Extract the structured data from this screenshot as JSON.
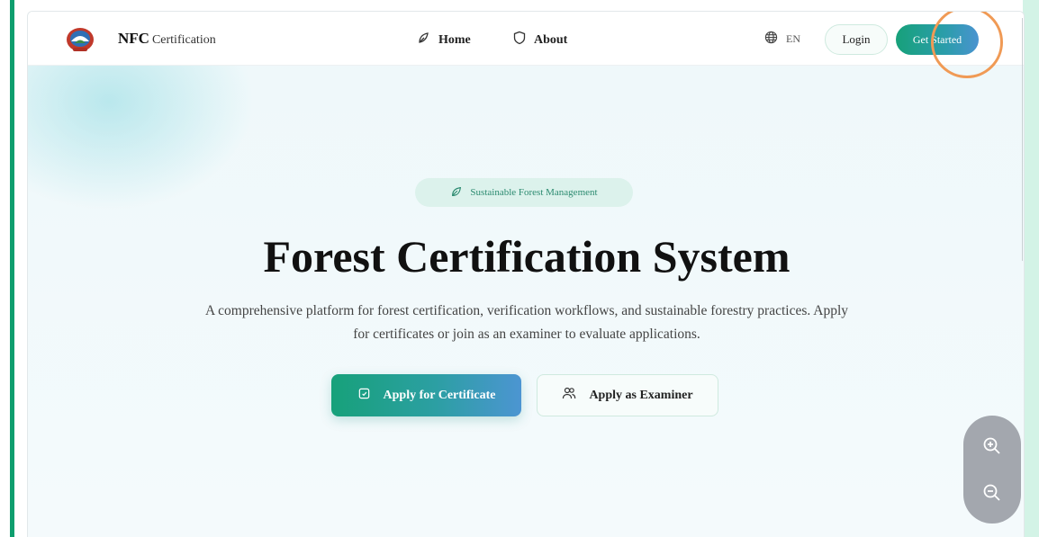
{
  "brand": {
    "name_bold": "NFC",
    "name_rest": "Certification",
    "logo_icon": "nepal-emblem-icon"
  },
  "nav": {
    "home_label": "Home",
    "about_label": "About",
    "language": "EN",
    "login_label": "Login",
    "get_started_label": "Get Started"
  },
  "hero": {
    "badge": "Sustainable Forest Management",
    "title": "Forest Certification System",
    "description": "A comprehensive platform for forest certification, verification workflows, and sustainable forestry practices. Apply for certificates or join as an examiner to evaluate applications.",
    "apply_certificate_label": "Apply for Certificate",
    "apply_examiner_label": "Apply as Examiner"
  },
  "colors": {
    "accent_green": "#17a17a",
    "accent_blue": "#4a93d0",
    "highlight_ring": "#f09a55",
    "left_bar": "#0e9e6e"
  },
  "icons": [
    "nepal-emblem-icon",
    "home-icon",
    "shield-icon",
    "globe-icon",
    "leaf-icon",
    "document-icon",
    "users-icon",
    "zoom-in-icon",
    "zoom-out-icon"
  ]
}
